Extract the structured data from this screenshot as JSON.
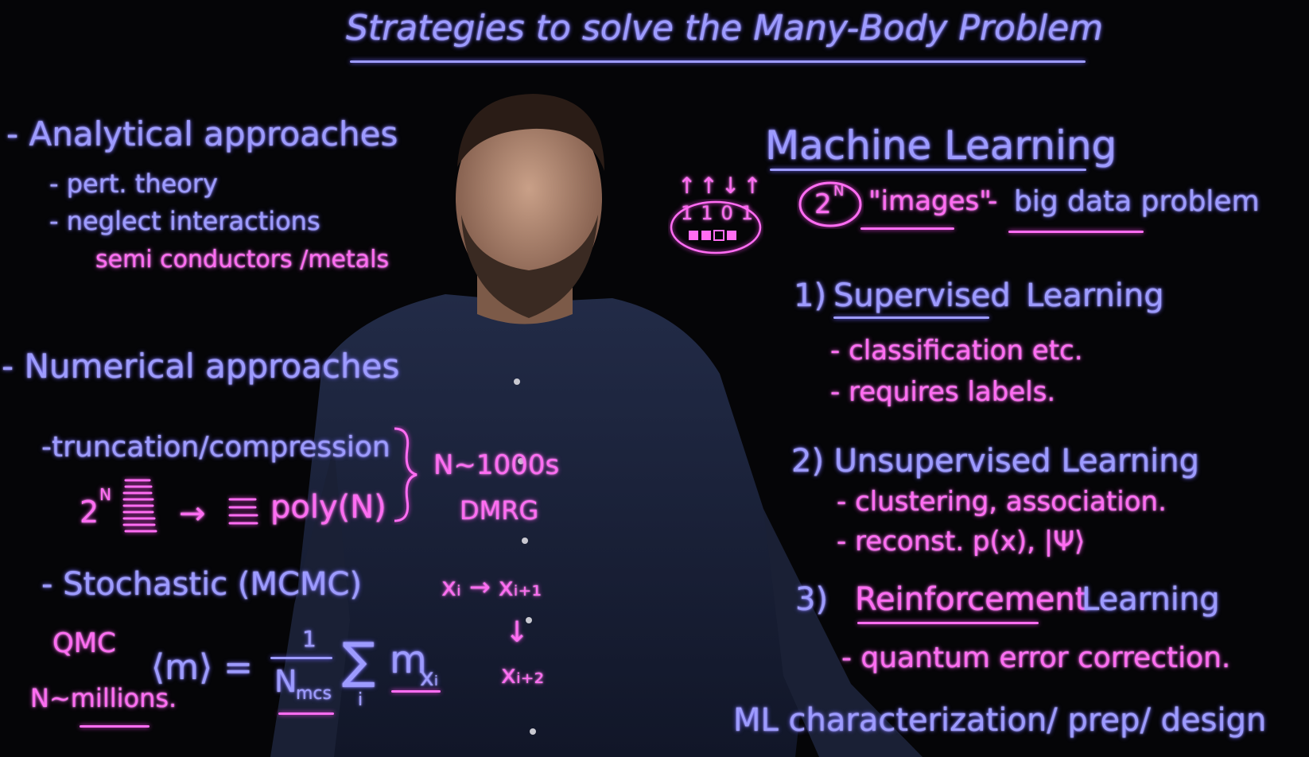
{
  "title": "Strategies to solve the Many-Body Problem",
  "left": {
    "analytical": {
      "heading": "- Analytical approaches",
      "items": [
        "- pert. theory",
        "- neglect interactions"
      ],
      "note": "semi conductors /metals"
    },
    "numerical": {
      "heading": "- Numerical approaches",
      "truncation": "-truncation/compression",
      "formula_2n": "2",
      "formula_n_sup": "N",
      "arrow": "→",
      "poly": "poly(N)",
      "brace_note_1": "N~1000s",
      "brace_note_2": "DMRG",
      "stochastic": "- Stochastic (MCMC)",
      "markov_1": "xᵢ → xᵢ₊₁",
      "markov_down": "↓",
      "markov_2": "xᵢ₊₂",
      "qmc": "QMC",
      "n_millions": "N~millions.",
      "avg_lhs": "⟨m⟩ =",
      "avg_num": "1",
      "avg_den": "N",
      "avg_den_sub": "mcs",
      "sum": "∑",
      "sum_sub": "i",
      "avg_term": "m",
      "avg_term_sub": "xᵢ"
    }
  },
  "right": {
    "heading": "Machine Learning",
    "spin_arrows": "↑↑↓↑",
    "spin_bits": "1101",
    "images_2n": "2",
    "images_2n_sup": "N",
    "images_label": "\"images\"",
    "dash": "-",
    "big_data": "big data problem",
    "supervised_num": "1)",
    "supervised_word": "Supervised",
    "supervised_rest": "Learning",
    "supervised_items": [
      "- classification etc.",
      "- requires labels."
    ],
    "unsupervised": "2) Unsupervised Learning",
    "unsupervised_items": [
      "- clustering, association.",
      "- reconst. p(x), |Ψ⟩"
    ],
    "reinforcement_num": "3)",
    "reinforcement_word": "Reinforcement",
    "reinforcement_rest": "Learning",
    "reinforcement_items": [
      "- quantum error correction."
    ],
    "ml_line": "ML characterization/ prep/ design"
  },
  "colors": {
    "background": "#050507",
    "blue_ink": "#9d9bff",
    "pink_ink": "#ff6df2",
    "shirt": "#1a2238"
  }
}
